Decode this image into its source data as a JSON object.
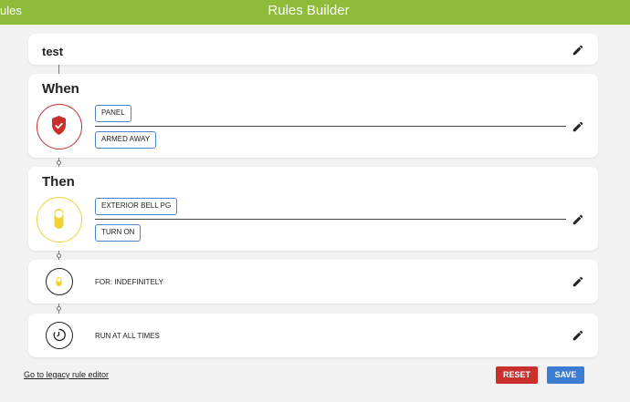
{
  "header": {
    "back_label": "ules",
    "title": "Rules Builder",
    "bg_color": "#8dbb3a"
  },
  "rule": {
    "name": "test"
  },
  "when": {
    "title": "When",
    "icon": "shield-check-icon",
    "device": "PANEL",
    "state": "ARMED AWAY",
    "color": "#c9302c"
  },
  "then": {
    "title": "Then",
    "icon": "toggle-switch-icon",
    "device": "EXTERIOR BELL PG",
    "action": "TURN ON",
    "color": "#f0d233"
  },
  "duration": {
    "icon": "timer-icon",
    "text": "FOR: INDEFINITELY"
  },
  "schedule": {
    "icon": "clock-icon",
    "text": "RUN AT ALL TIMES"
  },
  "footer": {
    "legacy_link": "Go to legacy rule editor",
    "reset_label": "RESET",
    "save_label": "SAVE",
    "reset_color": "#c9302c",
    "save_color": "#3b7dd3"
  }
}
